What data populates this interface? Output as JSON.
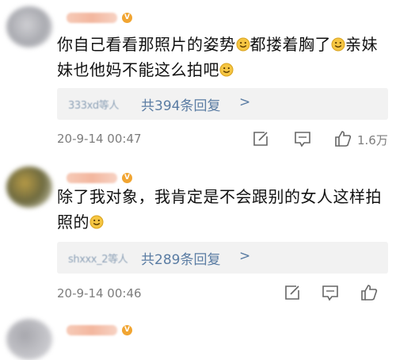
{
  "comments": [
    {
      "username": "",
      "text_parts": [
        "你自己看看那照片的姿势",
        "都搂着胸了",
        "亲妹妹也他妈不能这么拍吧"
      ],
      "reply_names": "333xd等人",
      "reply_count": "共394条回复",
      "reply_chevron": ">",
      "time": "20-9-14 00:47",
      "likes": "1.6万"
    },
    {
      "username": "",
      "text_parts": [
        "除了我对象，我肯定是不会跟别的女人这样拍照的"
      ],
      "reply_names": "shxxx_2等人",
      "reply_count": "共289条回复",
      "reply_chevron": ">",
      "time": "20-9-14 00:46",
      "likes": ""
    }
  ],
  "icons": {
    "emoji": "smile-emoji-icon",
    "share": "share-edit-icon",
    "comment": "comment-icon",
    "like": "thumbs-up-icon"
  },
  "colors": {
    "link_blue": "#5a7ca3",
    "meta_gray": "#7d7d7d",
    "reply_bg": "#f2f2f2",
    "text": "#111111"
  }
}
